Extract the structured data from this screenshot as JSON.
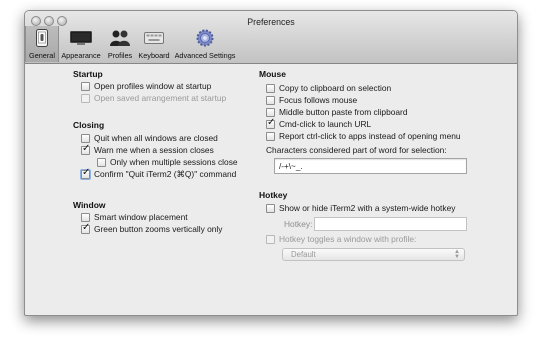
{
  "window": {
    "title": "Preferences"
  },
  "toolbar": {
    "items": [
      {
        "label": "General",
        "icon": "iphone-switch-icon",
        "selected": true
      },
      {
        "label": "Appearance",
        "icon": "monitor-icon",
        "selected": false
      },
      {
        "label": "Profiles",
        "icon": "people-icon",
        "selected": false
      },
      {
        "label": "Keyboard",
        "icon": "keyboard-icon",
        "selected": false
      },
      {
        "label": "Advanced Settings",
        "icon": "gear-icon",
        "selected": false
      }
    ]
  },
  "startup": {
    "heading": "Startup",
    "open_profiles": {
      "label": "Open profiles window at startup",
      "checked": false
    },
    "open_saved": {
      "label": "Open saved arrangement at startup",
      "checked": false,
      "disabled": true
    }
  },
  "closing": {
    "heading": "Closing",
    "quit_all_closed": {
      "label": "Quit when all windows are closed",
      "checked": false
    },
    "warn_session_closes": {
      "label": "Warn me when a session closes",
      "checked": true
    },
    "only_multiple": {
      "label": "Only when multiple sessions close",
      "checked": false
    },
    "confirm_quit": {
      "label": "Confirm \"Quit iTerm2 (⌘Q)\" command",
      "checked": true
    }
  },
  "window_section": {
    "heading": "Window",
    "smart_placement": {
      "label": "Smart window placement",
      "checked": false
    },
    "green_button": {
      "label": "Green button zooms vertically only",
      "checked": true
    }
  },
  "mouse": {
    "heading": "Mouse",
    "copy_clipboard": {
      "label": "Copy to clipboard on selection",
      "checked": false
    },
    "focus_follows": {
      "label": "Focus follows mouse",
      "checked": false
    },
    "middle_paste": {
      "label": "Middle button paste from clipboard",
      "checked": false
    },
    "cmd_click": {
      "label": "Cmd-click to launch URL",
      "checked": true
    },
    "report_ctrl": {
      "label": "Report ctrl-click to apps instead of opening menu",
      "checked": false
    },
    "word_chars_label": "Characters considered part of word for selection:",
    "word_chars_value": "/-+\\~_."
  },
  "hotkey": {
    "heading": "Hotkey",
    "show_hide": {
      "label": "Show or hide iTerm2 with a system-wide hotkey",
      "checked": false
    },
    "hotkey_label": "Hotkey:",
    "hotkey_value": "",
    "toggles_window": {
      "label": "Hotkey toggles a window with profile:",
      "checked": false,
      "disabled": true
    },
    "profile_select": "Default"
  }
}
